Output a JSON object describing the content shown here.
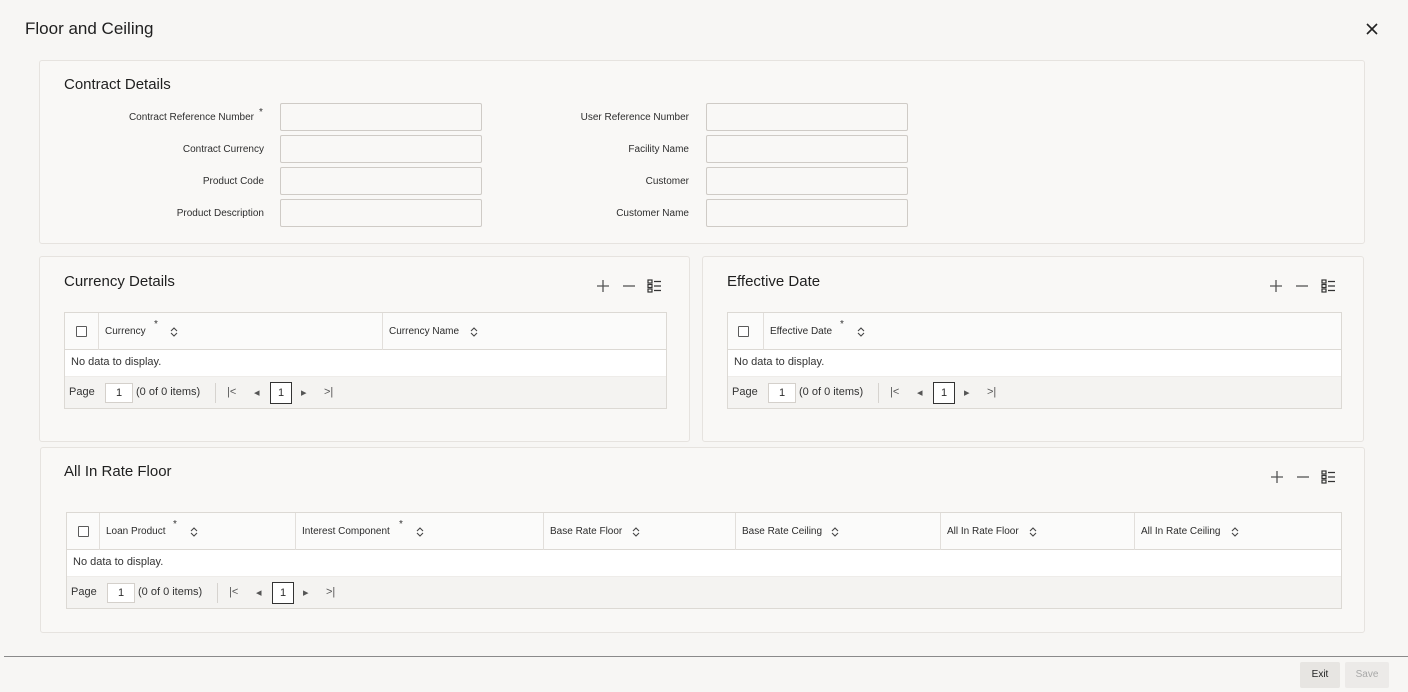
{
  "window": {
    "title": "Floor and Ceiling",
    "close_icon": "close-icon"
  },
  "contract_details": {
    "title": "Contract Details",
    "fields": {
      "contract_reference_number": {
        "label": "Contract Reference Number",
        "required": "*",
        "value": ""
      },
      "contract_currency": {
        "label": "Contract Currency",
        "value": ""
      },
      "product_code": {
        "label": "Product Code",
        "value": ""
      },
      "product_description": {
        "label": "Product Description",
        "value": ""
      },
      "user_reference_number": {
        "label": "User Reference Number",
        "value": ""
      },
      "facility_name": {
        "label": "Facility Name",
        "value": ""
      },
      "customer": {
        "label": "Customer",
        "value": ""
      },
      "customer_name": {
        "label": "Customer Name",
        "value": ""
      }
    }
  },
  "currency_details": {
    "title": "Currency Details",
    "columns": [
      {
        "label": "Currency",
        "required": "*"
      },
      {
        "label": "Currency Name"
      }
    ],
    "empty_text": "No data to display.",
    "pager": {
      "page_label": "Page",
      "page_value": "1",
      "count_text": "(0 of 0 items)",
      "current_page": "1"
    }
  },
  "effective_date": {
    "title": "Effective Date",
    "columns": [
      {
        "label": "Effective Date",
        "required": "*"
      }
    ],
    "empty_text": "No data to display.",
    "pager": {
      "page_label": "Page",
      "page_value": "1",
      "count_text": "(0 of 0 items)",
      "current_page": "1"
    }
  },
  "all_in_rate_floor": {
    "title": "All In Rate Floor",
    "columns": [
      {
        "label": "Loan Product",
        "required": "*"
      },
      {
        "label": "Interest Component",
        "required": "*"
      },
      {
        "label": "Base Rate Floor"
      },
      {
        "label": "Base Rate Ceiling"
      },
      {
        "label": "All In Rate Floor"
      },
      {
        "label": "All In Rate Ceiling"
      }
    ],
    "empty_text": "No data to display.",
    "pager": {
      "page_label": "Page",
      "page_value": "1",
      "count_text": "(0 of 0 items)",
      "current_page": "1"
    }
  },
  "pager_icons": {
    "first": "|<",
    "prev": "◂",
    "next": "▸",
    "last": ">|"
  },
  "footer": {
    "exit_label": "Exit",
    "save_label": "Save"
  }
}
